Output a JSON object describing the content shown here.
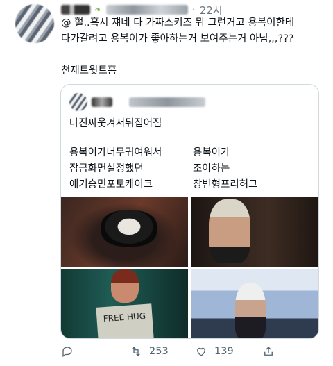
{
  "tweet": {
    "time": "22시",
    "line1": "@ 헐..혹시 쟤네 다 가짜스키즈 뭐 그런거고 용복이한테",
    "line2": "다가갈려고 용복이가 좋아하는거 보여주는거 아님,,,???",
    "extra": "천재트윗트홈"
  },
  "quote": {
    "first": "나진짜웃겨서뒤집어짐",
    "left": [
      "용복이가너무귀여워서",
      "잠금화면설정했던",
      "애기승민포토케이크"
    ],
    "right": [
      "용복이가",
      "조아하는",
      "창빈형프리허그"
    ],
    "sign_text": "FREE HUG"
  },
  "actions": {
    "retweets": "253",
    "likes": "139"
  },
  "colors": {
    "muted": "#536471",
    "border": "#cfd9de",
    "text": "#0f1419"
  },
  "icons": [
    "reply-icon",
    "retweet-icon",
    "like-icon",
    "share-icon"
  ]
}
